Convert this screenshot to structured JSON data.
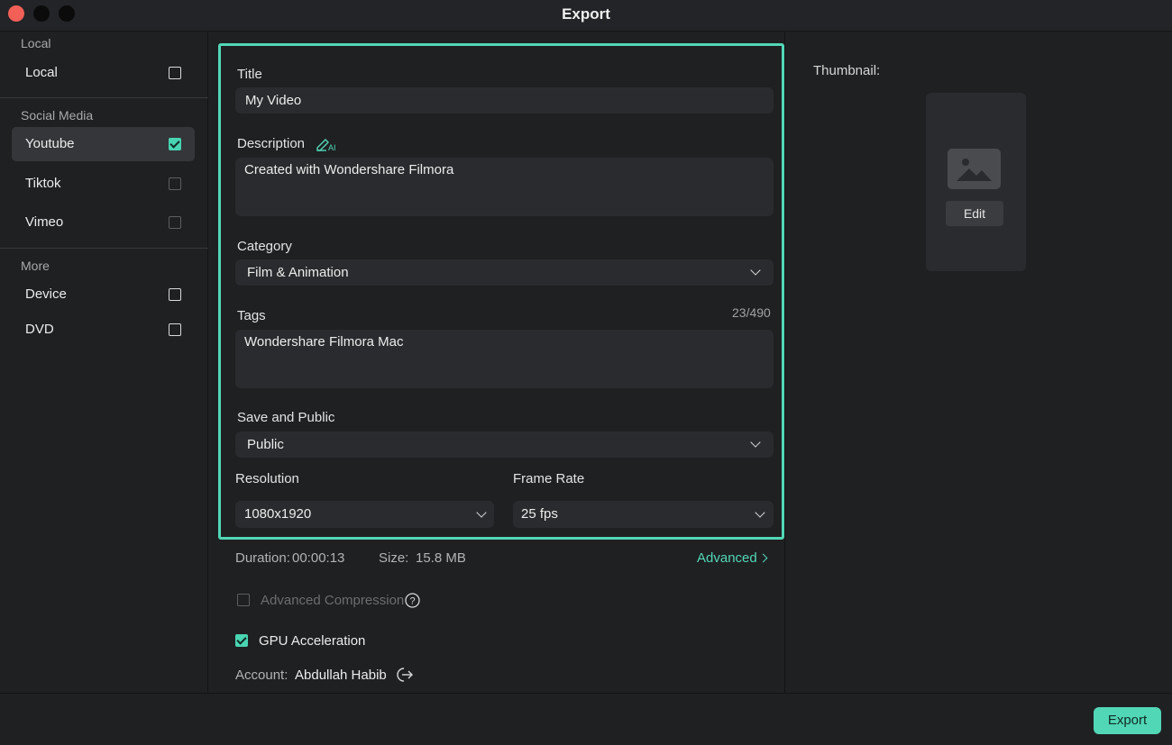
{
  "window": {
    "title": "Export"
  },
  "sidebar": {
    "sections": [
      {
        "heading": "Local",
        "items": [
          {
            "label": "Local",
            "checked": false
          }
        ]
      },
      {
        "heading": "Social Media",
        "items": [
          {
            "label": "Youtube",
            "checked": true,
            "active": true
          },
          {
            "label": "Tiktok",
            "checked": false
          },
          {
            "label": "Vimeo",
            "checked": false
          }
        ]
      },
      {
        "heading": "More",
        "items": [
          {
            "label": "Device",
            "checked": false
          },
          {
            "label": "DVD",
            "checked": false
          }
        ]
      }
    ]
  },
  "form": {
    "title_label": "Title",
    "title_value": "My Video",
    "description_label": "Description",
    "ai_icon_text": "AI",
    "description_value": "Created with Wondershare Filmora",
    "category_label": "Category",
    "category_value": "Film & Animation",
    "tags_label": "Tags",
    "tags_counter": "23/490",
    "tags_value": "Wondershare Filmora Mac",
    "save_label": "Save and Public",
    "save_value": "Public",
    "resolution_label": "Resolution",
    "resolution_value": "1080x1920",
    "framerate_label": "Frame Rate",
    "framerate_value": "25 fps"
  },
  "info": {
    "duration_label": "Duration:",
    "duration_value": "00:00:13",
    "size_label": "Size:",
    "size_value": "15.8 MB",
    "advanced_label": "Advanced",
    "advanced_compression_label": "Advanced Compression",
    "gpu_label": "GPU Acceleration",
    "account_label": "Account:",
    "account_value": "Abdullah Habib"
  },
  "thumbnail": {
    "label": "Thumbnail:",
    "edit_label": "Edit"
  },
  "footer": {
    "export_label": "Export"
  },
  "colors": {
    "accent": "#52d7b6",
    "close": "#f25f57",
    "panel": "#1f2022",
    "field": "#2a2b2e"
  }
}
